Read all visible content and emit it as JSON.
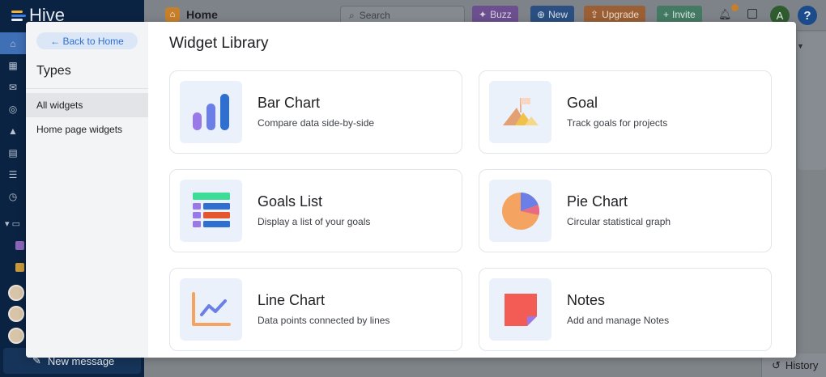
{
  "app": {
    "name": "Hive",
    "new_message_label": "New message"
  },
  "topbar": {
    "breadcrumb": "Home",
    "search_placeholder": "Search",
    "buzz_label": "Buzz",
    "new_label": "New",
    "upgrade_label": "Upgrade",
    "invite_label": "Invite",
    "user_initial": "A",
    "help_label": "?"
  },
  "history_label": "History",
  "modal": {
    "back_label": "← Back to Home",
    "types_title": "Types",
    "types": [
      {
        "label": "All widgets",
        "active": true
      },
      {
        "label": "Home page widgets",
        "active": false
      }
    ],
    "title": "Widget Library",
    "widgets": [
      {
        "title": "Bar Chart",
        "description": "Compare data side-by-side",
        "icon": "bar-chart-icon"
      },
      {
        "title": "Goal",
        "description": "Track goals for projects",
        "icon": "goal-mountain-icon"
      },
      {
        "title": "Goals List",
        "description": "Display a list of your goals",
        "icon": "goals-list-icon"
      },
      {
        "title": "Pie Chart",
        "description": "Circular statistical graph",
        "icon": "pie-chart-icon"
      },
      {
        "title": "Line Chart",
        "description": "Data points connected by lines",
        "icon": "line-chart-icon"
      },
      {
        "title": "Notes",
        "description": "Add and manage Notes",
        "icon": "notes-icon"
      }
    ]
  },
  "colors": {
    "accent_blue": "#2f6fcf",
    "icon_bg": "#ebf1fa",
    "sidebar_bg": "#0b2342"
  }
}
